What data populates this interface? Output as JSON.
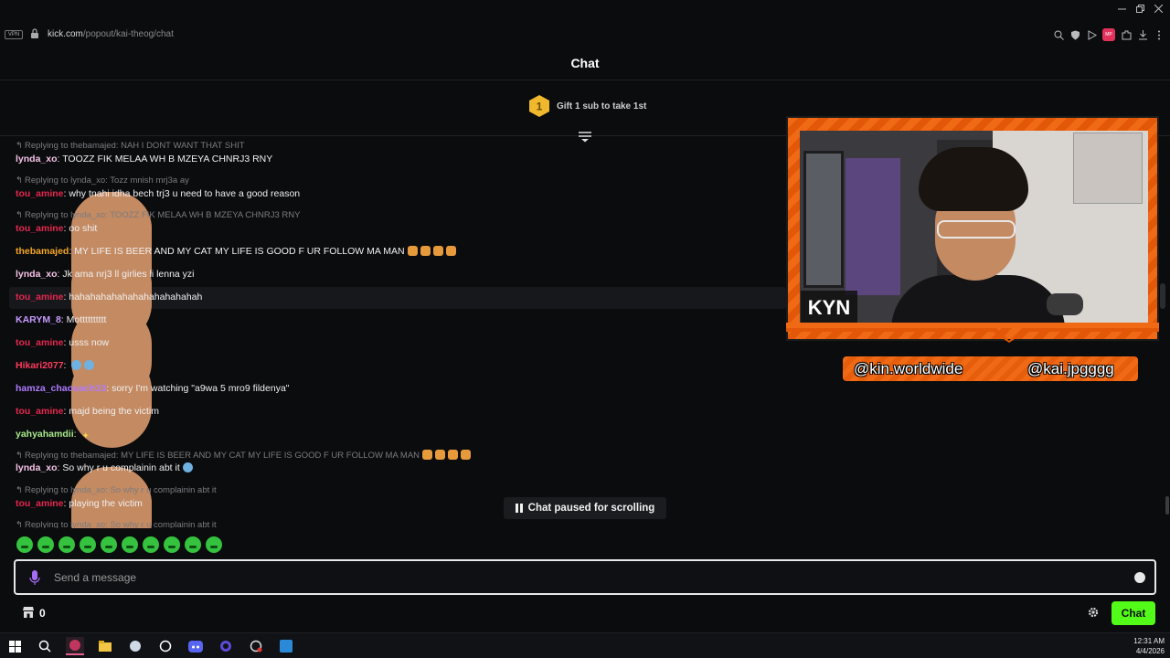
{
  "browser": {
    "vpn_label": "VPN",
    "url_host": "kick.com",
    "url_path": "/popout/kai-theog/chat",
    "extension_label": "MP"
  },
  "header": {
    "title": "Chat"
  },
  "gift": {
    "rank": "1",
    "text": "Gift 1 sub to take 1st"
  },
  "messages": [
    {
      "kind": "reply",
      "text": "Replying to thebamajed: NAH I DONT WANT THAT SHIT"
    },
    {
      "kind": "msg",
      "user": "lynda_xo",
      "color": "#f5c2e7",
      "text": "TOOZZ FIK MELAA WH B MZEYA CHNRJ3 RNY",
      "emotes": [
        "face",
        "face"
      ]
    },
    {
      "kind": "reply",
      "text": "Replying to lynda_xo: Tozz mnish mrj3a ay",
      "emotes": [
        "face",
        "face",
        "face"
      ]
    },
    {
      "kind": "msg",
      "user": "tou_amine",
      "color": "#e3274e",
      "text": "why tnahi idha bech trj3 u need to have a good reason"
    },
    {
      "kind": "reply",
      "text": "Replying to lynda_xo: TOOZZ FIK MELAA WH B MZEYA CHNRJ3 RNY",
      "emotes": [
        "face",
        "face"
      ]
    },
    {
      "kind": "msg",
      "user": "tou_amine",
      "color": "#e3274e",
      "text": "oo shit"
    },
    {
      "kind": "msg",
      "user": "thebamajed",
      "color": "#f5a623",
      "text": "MY LIFE IS BEER AND MY CAT MY LIFE IS GOOD F UR FOLLOW MA MAN",
      "emotes": [
        "cat",
        "cat",
        "cat",
        "cat"
      ]
    },
    {
      "kind": "msg",
      "user": "lynda_xo",
      "color": "#f5c2e7",
      "text": "Jk ama nrj3 ll girlies li lenna yzi",
      "emotes": [
        "face"
      ]
    },
    {
      "kind": "msg",
      "user": "tou_amine",
      "color": "#e3274e",
      "text": "hahahahahahahahahahahahah"
    },
    {
      "kind": "msg",
      "user": "KARYM_8",
      "color": "#c79bff",
      "text": "Motttttttttt",
      "emotes": [
        "face"
      ]
    },
    {
      "kind": "msg",
      "user": "tou_amine",
      "color": "#e3274e",
      "text": "usss now"
    },
    {
      "kind": "msg",
      "user": "Hikari2077",
      "color": "#ff3b5c",
      "text": "",
      "emotes": [
        "cry",
        "cry"
      ]
    },
    {
      "kind": "msg",
      "user": "hamza_chaouach13",
      "color": "#b07cff",
      "text": "sorry I'm watching \"a9wa 5 mro9 fildenya\""
    },
    {
      "kind": "msg",
      "user": "tou_amine",
      "color": "#e3274e",
      "text": "majd being the victim"
    },
    {
      "kind": "msg",
      "user": "yahyahamdii",
      "color": "#a8e88a",
      "text": "",
      "emotes": [
        "face",
        "face",
        "spark"
      ]
    },
    {
      "kind": "reply",
      "text": "Replying to thebamajed: MY LIFE IS BEER AND MY CAT MY LIFE IS GOOD F UR FOLLOW MA MAN",
      "emotes": [
        "cat",
        "cat",
        "cat",
        "cat"
      ]
    },
    {
      "kind": "msg",
      "user": "lynda_xo",
      "color": "#f5c2e7",
      "text": "So why r u complainin abt it",
      "emotes": [
        "cry"
      ]
    },
    {
      "kind": "reply",
      "text": "Replying to lynda_xo: So why r u complainin abt it",
      "emotes": [
        "face"
      ]
    },
    {
      "kind": "msg",
      "user": "tou_amine",
      "color": "#e3274e",
      "text": "playing the victim"
    },
    {
      "kind": "reply",
      "text": "Replying to lynda_xo: So why r u complainin abt it",
      "emotes": [
        "face"
      ]
    }
  ],
  "stream": {
    "logo_text": "KYN",
    "handle_left": "@kin.worldwide",
    "handle_right": "@kai.jpgggg"
  },
  "paused": {
    "label": "Chat paused for scrolling"
  },
  "emote_bar": {
    "count": 10
  },
  "input": {
    "placeholder": "Send a message",
    "value": ""
  },
  "footer": {
    "points": "0",
    "chat_button": "Chat"
  },
  "taskbar": {
    "time": "12:31 AM",
    "date": "4/4/2026"
  },
  "colors": {
    "accent": "#53fc18",
    "frame_orange": "#f06a16"
  }
}
